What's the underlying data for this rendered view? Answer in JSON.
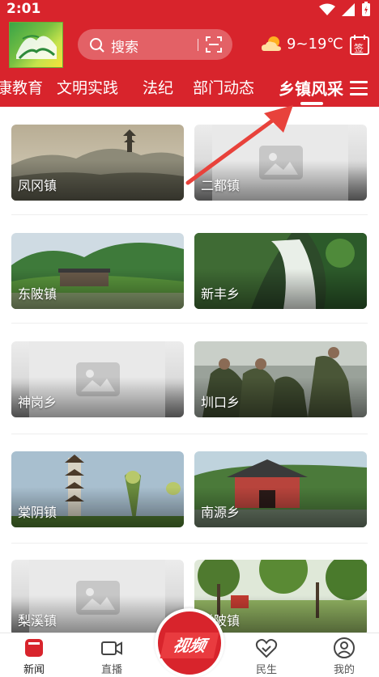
{
  "status_bar": {
    "time": "2:01"
  },
  "header": {
    "search_placeholder": "搜索",
    "weather_text": "9~19℃",
    "sign_label": "签"
  },
  "tabs": [
    {
      "label": "康教育"
    },
    {
      "label": "文明实践"
    },
    {
      "label": "法纪"
    },
    {
      "label": "部门动态"
    },
    {
      "label": "乡镇风采",
      "active": true
    }
  ],
  "towns": [
    {
      "name": "凤冈镇"
    },
    {
      "name": "二都镇"
    },
    {
      "name": "东陂镇"
    },
    {
      "name": "新丰乡"
    },
    {
      "name": "神岗乡"
    },
    {
      "name": "圳口乡"
    },
    {
      "name": "棠阴镇"
    },
    {
      "name": "南源乡"
    },
    {
      "name": "梨溪镇"
    },
    {
      "name": "洋陂镇"
    }
  ],
  "bottom_nav": {
    "news": "新闻",
    "live": "直播",
    "video": "视频",
    "livelihood": "民生",
    "mine": "我的"
  },
  "colors": {
    "brand_red": "#d8242c"
  }
}
